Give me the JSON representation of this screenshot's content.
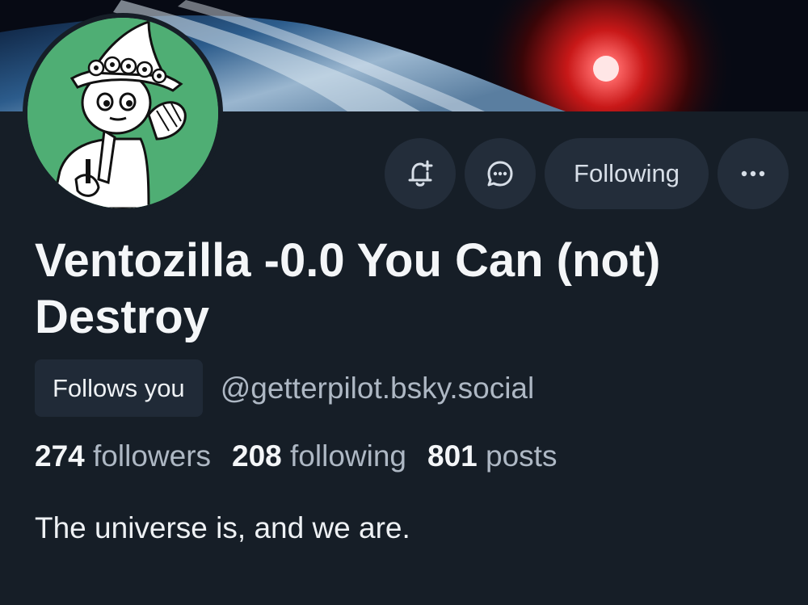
{
  "profile": {
    "display_name": "Ventozilla -0.0 You Can (not) Destroy",
    "handle": "@getterpilot.bsky.social",
    "follows_you_badge": "Follows you",
    "bio": "The universe is, and we are."
  },
  "stats": {
    "followers_count": "274",
    "followers_label": "followers",
    "following_count": "208",
    "following_label": "following",
    "posts_count": "801",
    "posts_label": "posts"
  },
  "actions": {
    "subscribe_icon": "bell-plus-icon",
    "message_icon": "chat-bubble-icon",
    "following_label": "Following",
    "more_icon": "ellipsis-icon"
  },
  "banner": {
    "image": "earth-from-space-with-red-light"
  },
  "avatar": {
    "image": "snufkin-cartoon-on-green"
  },
  "colors": {
    "background": "#161e27",
    "button_bg": "#232d3a",
    "muted_text": "#aeb8c4",
    "avatar_green": "#4fae74"
  }
}
